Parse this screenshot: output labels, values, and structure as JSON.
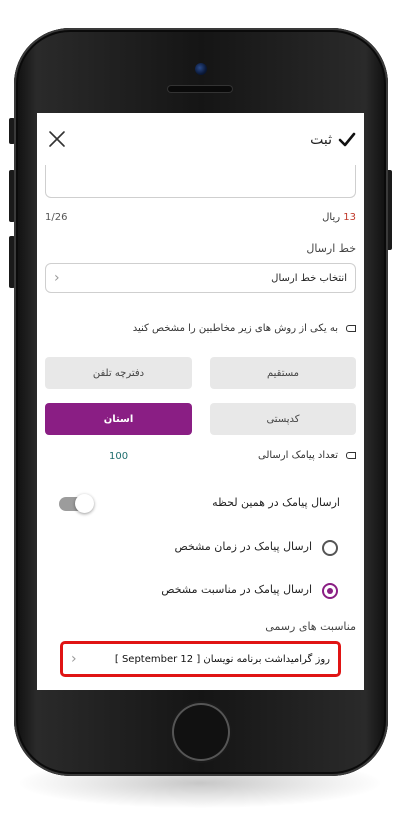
{
  "header": {
    "submit_label": "ثبت",
    "submit_icon": "check-icon",
    "close_icon": "close-icon"
  },
  "message": {
    "counter": "1/26",
    "price_value": "13",
    "price_unit": "ریال"
  },
  "line": {
    "label": "خط ارسال",
    "select_value": "انتخاب خط ارسال"
  },
  "recipients": {
    "prompt": "به یکی از روش های زیر مخاطبین را مشخص کنید",
    "buttons": [
      {
        "label": "مستقیم",
        "active": false
      },
      {
        "label": "دفترچه تلفن",
        "active": false
      },
      {
        "label": "کدپستی",
        "active": false
      },
      {
        "label": "استان",
        "active": true
      }
    ]
  },
  "sms_count": {
    "label": "تعداد پیامک ارسالی",
    "value": "100"
  },
  "send_options": {
    "immediate_label": "ارسال پیامک در همین لحظه",
    "immediate_on": false,
    "scheduled_label": "ارسال پیامک در زمان مشخص",
    "occasion_label": "ارسال پیامک در مناسبت مشخص",
    "selected": "occasion"
  },
  "occasion": {
    "label": "مناسبت های رسمی",
    "select_value": "روز گرامیداشت برنامه نویسان [ 12 September ]"
  },
  "colors": {
    "accent": "#8a1e84",
    "price": "#c0392b",
    "count": "#1f6f6f",
    "highlight": "#e01414"
  }
}
